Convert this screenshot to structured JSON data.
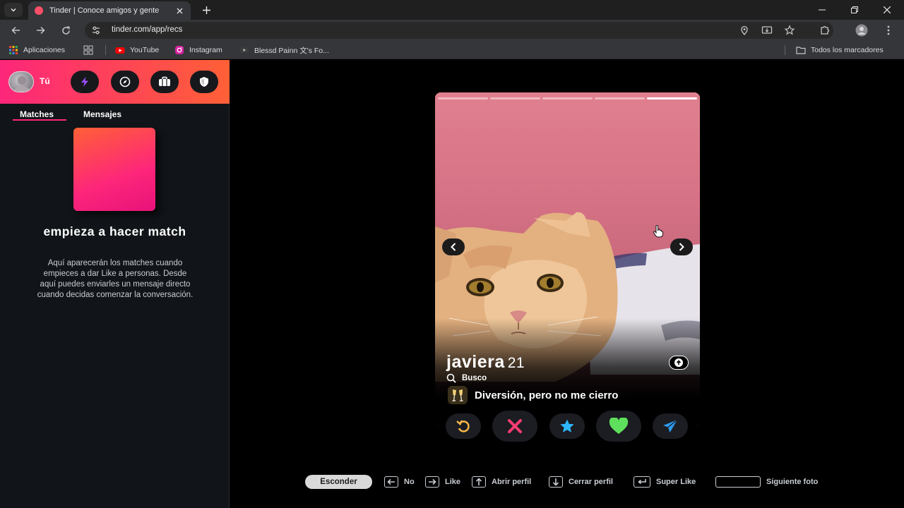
{
  "browser": {
    "tab_title": "Tinder | Conoce amigos y gente",
    "url": "tinder.com/app/recs",
    "bookmarks": [
      {
        "label": "Aplicaciones",
        "icon": "apps-grid-icon"
      },
      {
        "label": "YouTube",
        "icon": "youtube-icon"
      },
      {
        "label": "Instagram",
        "icon": "instagram-icon"
      },
      {
        "label": "Blessd Painn 文's Fo...",
        "icon": "video-icon"
      }
    ],
    "all_bookmarks": "Todos los marcadores"
  },
  "sidebar": {
    "me_label": "Tú",
    "tabs": [
      {
        "label": "Matches",
        "active": true
      },
      {
        "label": "Mensajes",
        "active": false
      }
    ],
    "empty_title": "empieza a hacer match",
    "empty_text": "Aquí aparecerán los matches cuando empieces a dar Like a personas. Desde aquí puedes enviarles un mensaje directo cuando decidas comenzar la conversación."
  },
  "profile": {
    "name": "javiera",
    "age": "21",
    "looking_label": "Busco",
    "looking_value": "Diversión, pero no me cierro",
    "photo_count": 5,
    "active_photo": 5
  },
  "shortcuts": {
    "hide": "Esconder",
    "no": "No",
    "like": "Like",
    "open_profile": "Abrir perfil",
    "close_profile": "Cerrar perfil",
    "super_like": "Super Like",
    "next_photo": "Siguiente foto"
  },
  "colors": {
    "brand_start": "#fd267a",
    "brand_end": "#ff6036",
    "rewind": "#f5b748",
    "nope": "#fe3c72",
    "superlike": "#2db8ff",
    "like": "#5fe05c",
    "boost": "#2d9bf0"
  }
}
